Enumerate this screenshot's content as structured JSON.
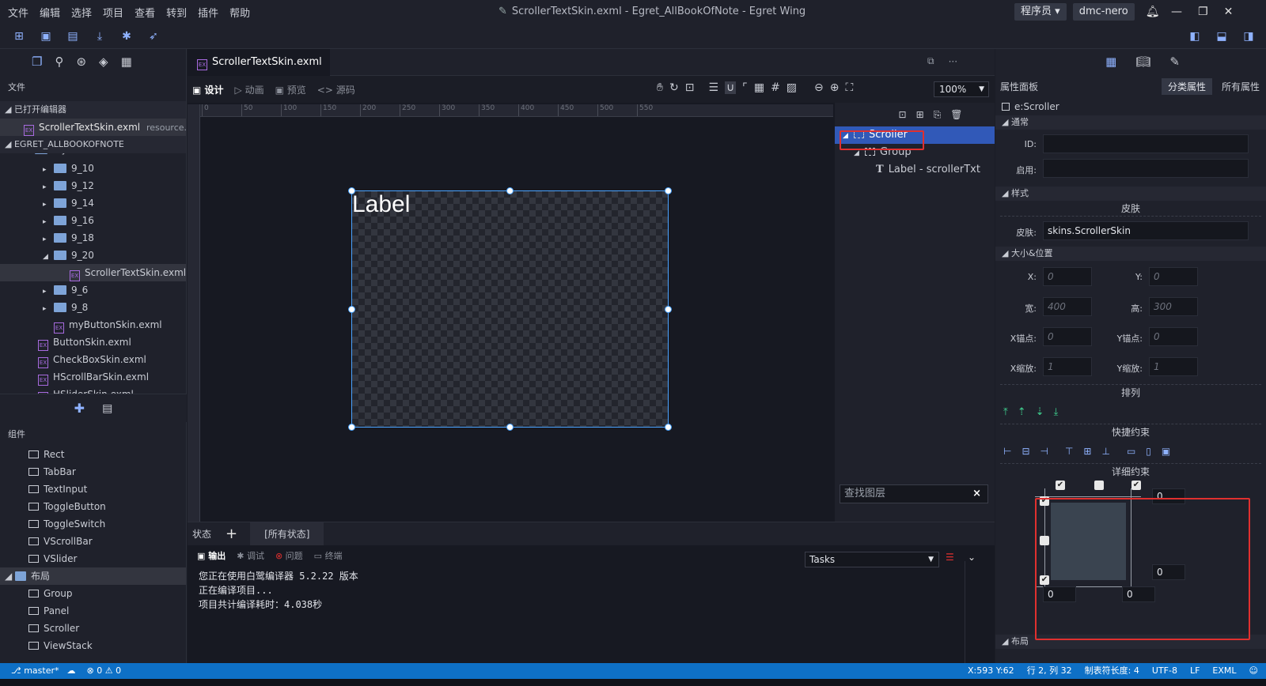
{
  "menu": [
    "文件",
    "编辑",
    "选择",
    "项目",
    "查看",
    "转到",
    "插件",
    "帮助"
  ],
  "window_title": "ScrollerTextSkin.exml - Egret_AllBookOfNote - Egret Wing",
  "role": "程序员",
  "user": "dmc-nero",
  "left": {
    "files_label": "文件",
    "open_editors": "已打开编辑器",
    "open_file": "ScrollerTextSkin.exml",
    "open_file_path": "resource...",
    "project": "EGRET_ALLBOOKOFNOTE",
    "partial_folder": "myExml",
    "tree": [
      {
        "label": "9_10",
        "type": "folder",
        "depth": 1,
        "arrow": "▸"
      },
      {
        "label": "9_12",
        "type": "folder",
        "depth": 1,
        "arrow": "▸"
      },
      {
        "label": "9_14",
        "type": "folder",
        "depth": 1,
        "arrow": "▸"
      },
      {
        "label": "9_16",
        "type": "folder",
        "depth": 1,
        "arrow": "▸"
      },
      {
        "label": "9_18",
        "type": "folder",
        "depth": 1,
        "arrow": "▸"
      },
      {
        "label": "9_20",
        "type": "folder",
        "depth": 1,
        "arrow": "◢"
      },
      {
        "label": "ScrollerTextSkin.exml",
        "type": "exml",
        "depth": 2,
        "arrow": "",
        "selected": true
      },
      {
        "label": "9_6",
        "type": "folder",
        "depth": 1,
        "arrow": "▸"
      },
      {
        "label": "9_8",
        "type": "folder",
        "depth": 1,
        "arrow": "▸"
      },
      {
        "label": "myButtonSkin.exml",
        "type": "exml",
        "depth": 1,
        "arrow": ""
      },
      {
        "label": "ButtonSkin.exml",
        "type": "exml",
        "depth": 0,
        "arrow": ""
      },
      {
        "label": "CheckBoxSkin.exml",
        "type": "exml",
        "depth": 0,
        "arrow": ""
      },
      {
        "label": "HScrollBarSkin.exml",
        "type": "exml",
        "depth": 0,
        "arrow": ""
      },
      {
        "label": "HSliderSkin.exml",
        "type": "exml",
        "depth": 0,
        "arrow": ""
      }
    ],
    "components_label": "组件",
    "components": [
      "Rect",
      "TabBar",
      "TextInput",
      "ToggleButton",
      "ToggleSwitch",
      "VScrollBar",
      "VSlider"
    ],
    "layout_label": "布局",
    "layout_items": [
      "Group",
      "Panel",
      "Scroller",
      "ViewStack"
    ]
  },
  "tab": {
    "label": "ScrollerTextSkin.exml",
    "close": "×",
    "more": "···"
  },
  "modes": [
    "设计",
    "动画",
    "预览",
    "源码"
  ],
  "zoom": "100%",
  "ruler_ticks": [
    "0",
    "50",
    "100",
    "150",
    "200",
    "250",
    "300",
    "350",
    "400",
    "450",
    "500",
    "550"
  ],
  "canvas_label": "Label",
  "layers": {
    "items": [
      {
        "label": "Scroller",
        "depth": 0,
        "arrow": "◢",
        "selected": true
      },
      {
        "label": "Group",
        "depth": 1,
        "arrow": "◢"
      },
      {
        "label": "Label - scrollerTxt",
        "depth": 2,
        "arrow": "",
        "text_icon": true
      }
    ],
    "search_placeholder": "查找图层",
    "search_clear": "×"
  },
  "states": {
    "label": "状态",
    "add": "+",
    "all": "[所有状态]"
  },
  "output": {
    "tabs": [
      "输出",
      "调试",
      "问题",
      "终端"
    ],
    "select": "Tasks",
    "lines": [
      "您正在使用白鹭编译器 5.2.22 版本",
      "正在编译项目...",
      "项目共计编译耗时：4.038秒"
    ]
  },
  "props": {
    "title": "属性面板",
    "cat_btn": "分类属性",
    "all_btn": "所有属性",
    "element": "e:Scroller",
    "general": "通常",
    "id_label": "ID:",
    "enabled_label": "启用:",
    "style": "样式",
    "skin_sub": "皮肤",
    "skin_label": "皮肤:",
    "skin_value": "skins.ScrollerSkin",
    "size_pos": "大小&位置",
    "x_label": "X:",
    "x_val": "0",
    "y_label": "Y:",
    "y_val": "0",
    "w_label": "宽:",
    "w_val": "400",
    "h_label": "高:",
    "h_val": "300",
    "ax_label": "X锚点:",
    "ax_val": "0",
    "ay_label": "Y锚点:",
    "ay_val": "0",
    "sx_label": "X缩放:",
    "sx_val": "1",
    "sy_label": "Y缩放:",
    "sy_val": "1",
    "arrange": "排列",
    "quick": "快捷约束",
    "detail": "详细约束",
    "c_right_top": "0",
    "c_right_bottom": "0",
    "c_bottom_left": "0",
    "c_bottom_right": "0",
    "layout": "布局"
  },
  "status": {
    "branch": "master*",
    "errors": "0",
    "warnings": "0",
    "coords": "X:593 Y:62",
    "position": "行 2, 列 32",
    "tab_size": "制表符长度: 4",
    "encoding": "UTF-8",
    "eol": "LF",
    "lang": "EXML"
  }
}
